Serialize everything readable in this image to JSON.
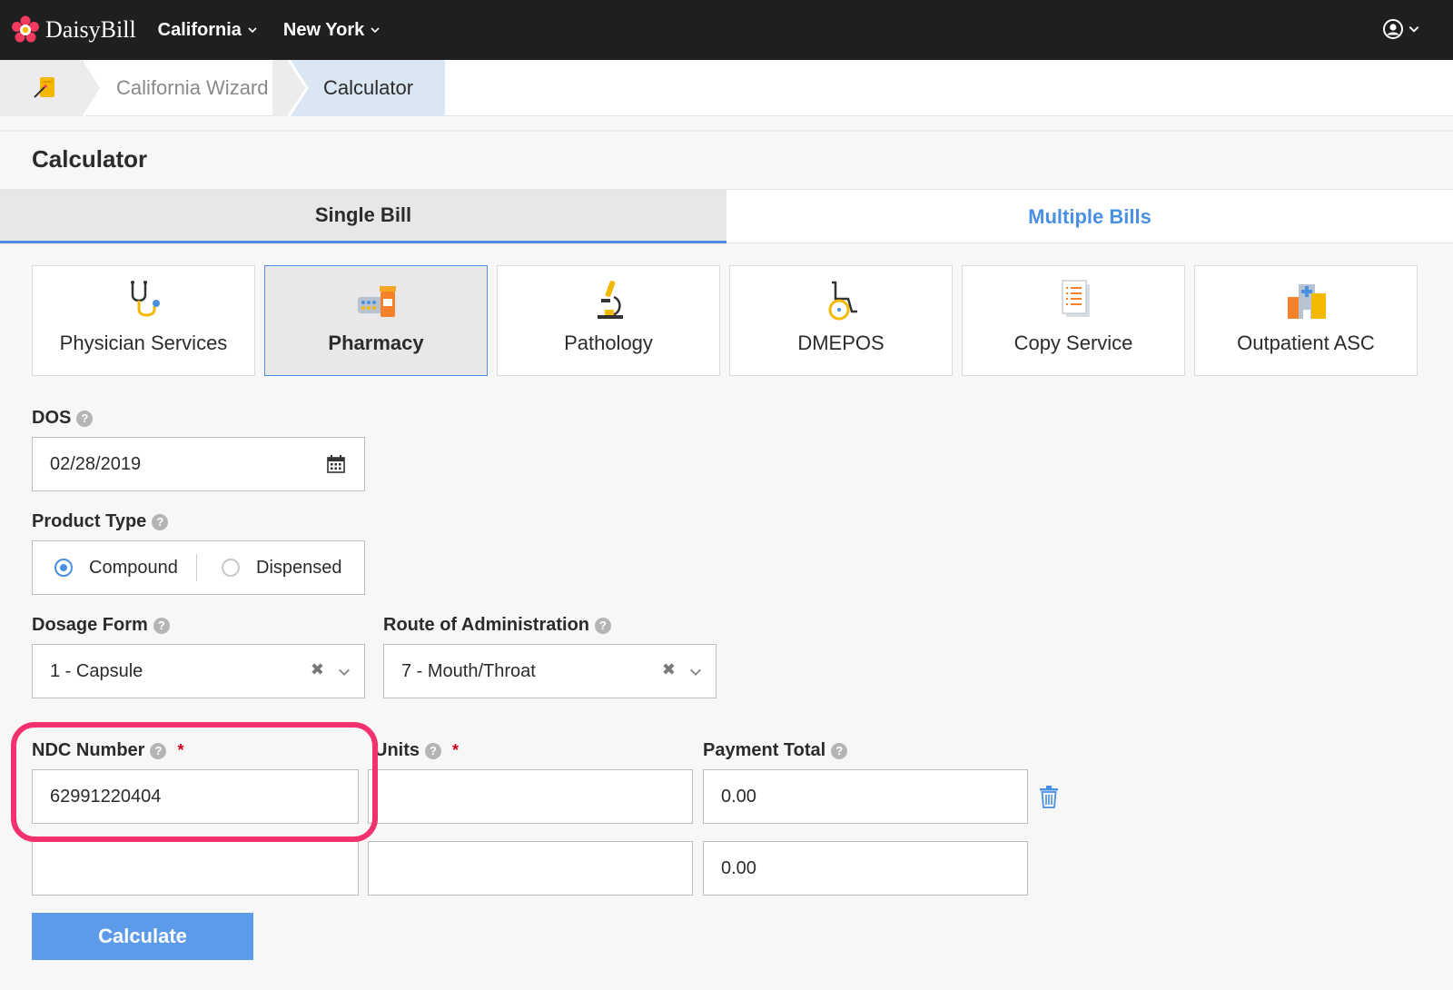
{
  "app": {
    "brand": "DaisyBill",
    "nav": [
      {
        "label": "California"
      },
      {
        "label": "New York"
      }
    ]
  },
  "breadcrumb": {
    "items": [
      "California Wizard",
      "Calculator"
    ]
  },
  "page": {
    "title": "Calculator"
  },
  "tabs": [
    {
      "label": "Single Bill",
      "active": true
    },
    {
      "label": "Multiple Bills",
      "active": false
    }
  ],
  "services": [
    {
      "label": "Physician Services",
      "icon": "stethoscope-icon"
    },
    {
      "label": "Pharmacy",
      "icon": "pharmacy-icon",
      "active": true
    },
    {
      "label": "Pathology",
      "icon": "microscope-icon"
    },
    {
      "label": "DMEPOS",
      "icon": "wheelchair-icon"
    },
    {
      "label": "Copy Service",
      "icon": "document-icon"
    },
    {
      "label": "Outpatient ASC",
      "icon": "hospital-icon"
    }
  ],
  "form": {
    "dos": {
      "label": "DOS",
      "value": "02/28/2019"
    },
    "product_type": {
      "label": "Product Type",
      "options": [
        "Compound",
        "Dispensed"
      ],
      "selected": "Compound"
    },
    "dosage_form": {
      "label": "Dosage Form",
      "value": "1 - Capsule"
    },
    "route": {
      "label": "Route of Administration",
      "value": "7 - Mouth/Throat"
    },
    "ndc": {
      "label": "NDC Number",
      "required_mark": "*"
    },
    "units": {
      "label": "Units",
      "required_mark": "*"
    },
    "payment_total": {
      "label": "Payment Total"
    },
    "rows": [
      {
        "ndc": "62991220404",
        "units": "",
        "payment": "0.00"
      },
      {
        "ndc": "",
        "units": "",
        "payment": "0.00"
      }
    ],
    "calculate_label": "Calculate"
  },
  "colors": {
    "accent": "#4a90e2",
    "button": "#5b9bea",
    "highlight": "#f2326e",
    "topbar": "#1f1f1f"
  }
}
